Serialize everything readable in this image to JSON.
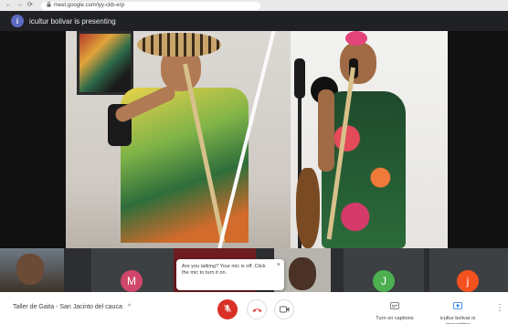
{
  "browser": {
    "url": "meet.google.com/iyy-ckb-erp",
    "back_icon": "←",
    "forward_icon": "→",
    "reload_icon": "⟳",
    "lock_icon": "🔒"
  },
  "presenter_bar": {
    "avatar_letter": "i",
    "text": "icultur bolivar is presenting"
  },
  "participants": [
    {
      "kind": "video"
    },
    {
      "kind": "avatar",
      "letter": "M",
      "color": "#d0476b"
    },
    {
      "kind": "video"
    },
    {
      "kind": "video"
    },
    {
      "kind": "avatar",
      "letter": "J",
      "color": "#4caf50"
    },
    {
      "kind": "avatar",
      "letter": "j",
      "color": "#f4511e"
    }
  ],
  "tooltip": {
    "text": "Are you talking? Your mic is off. Click the mic to turn it on.",
    "close_icon": "×"
  },
  "bottom_bar": {
    "meeting_title": "Taller de Gaita - San Jacinto del cauca",
    "chevron_icon": "^",
    "captions_label": "Turn on captions",
    "presenting_label": "icultur bolivar is presenting",
    "more_icon": "⋮"
  },
  "colors": {
    "mic_off": "#d93025",
    "hangup": "#d93025",
    "presenter_avatar": "#5c6bc0"
  }
}
